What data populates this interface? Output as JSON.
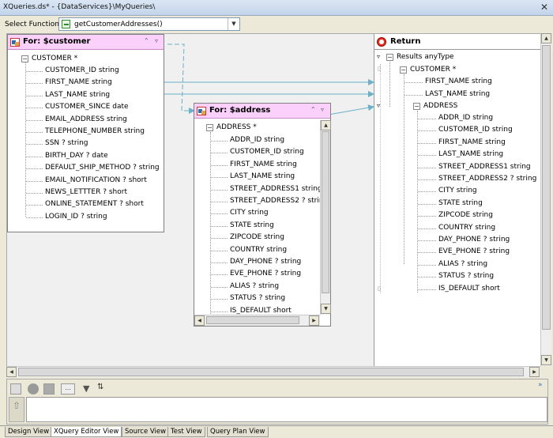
{
  "window": {
    "title": "XQueries.ds* - {DataServices}\\MyQueries\\"
  },
  "function_bar": {
    "label": "Select Function:",
    "value": "getCustomerAddresses()"
  },
  "customer_panel": {
    "title": "For: $customer",
    "root": "CUSTOMER *",
    "fields": [
      "CUSTOMER_ID string",
      "FIRST_NAME string",
      "LAST_NAME string",
      "CUSTOMER_SINCE date",
      "EMAIL_ADDRESS string",
      "TELEPHONE_NUMBER string",
      "SSN ? string",
      "BIRTH_DAY ? date",
      "DEFAULT_SHIP_METHOD ? string",
      "EMAIL_NOTIFICATION ? short",
      "NEWS_LETTTER ? short",
      "ONLINE_STATEMENT ? short",
      "LOGIN_ID ? string"
    ]
  },
  "address_panel": {
    "title": "For: $address",
    "root": "ADDRESS *",
    "fields": [
      "ADDR_ID string",
      "CUSTOMER_ID string",
      "FIRST_NAME string",
      "LAST_NAME string",
      "STREET_ADDRESS1 string",
      "STREET_ADDRESS2 ? strin",
      "CITY string",
      "STATE string",
      "ZIPCODE string",
      "COUNTRY string",
      "DAY_PHONE ? string",
      "EVE_PHONE ? string",
      "ALIAS ? string",
      "STATUS ? string",
      "IS_DEFAULT short"
    ]
  },
  "return_panel": {
    "title": "Return",
    "results": "Results anyType",
    "customer": "CUSTOMER *",
    "customer_fields": [
      "FIRST_NAME string",
      "LAST_NAME string"
    ],
    "address": "ADDRESS",
    "address_fields": [
      "ADDR_ID string",
      "CUSTOMER_ID string",
      "FIRST_NAME string",
      "LAST_NAME string",
      "STREET_ADDRESS1 string",
      "STREET_ADDRESS2 ? string",
      "CITY string",
      "STATE string",
      "ZIPCODE string",
      "COUNTRY string",
      "DAY_PHONE ? string",
      "EVE_PHONE ? string",
      "ALIAS ? string",
      "STATUS ? string",
      "IS_DEFAULT short"
    ]
  },
  "bottom_tabs": [
    "Design View",
    "XQuery Editor View",
    "Source View",
    "Test View",
    "Query Plan View"
  ],
  "colors": {
    "panel_header": "#fbd0fb",
    "link_line": "#6ab0c8",
    "title_bar": "#c3d4ea"
  }
}
